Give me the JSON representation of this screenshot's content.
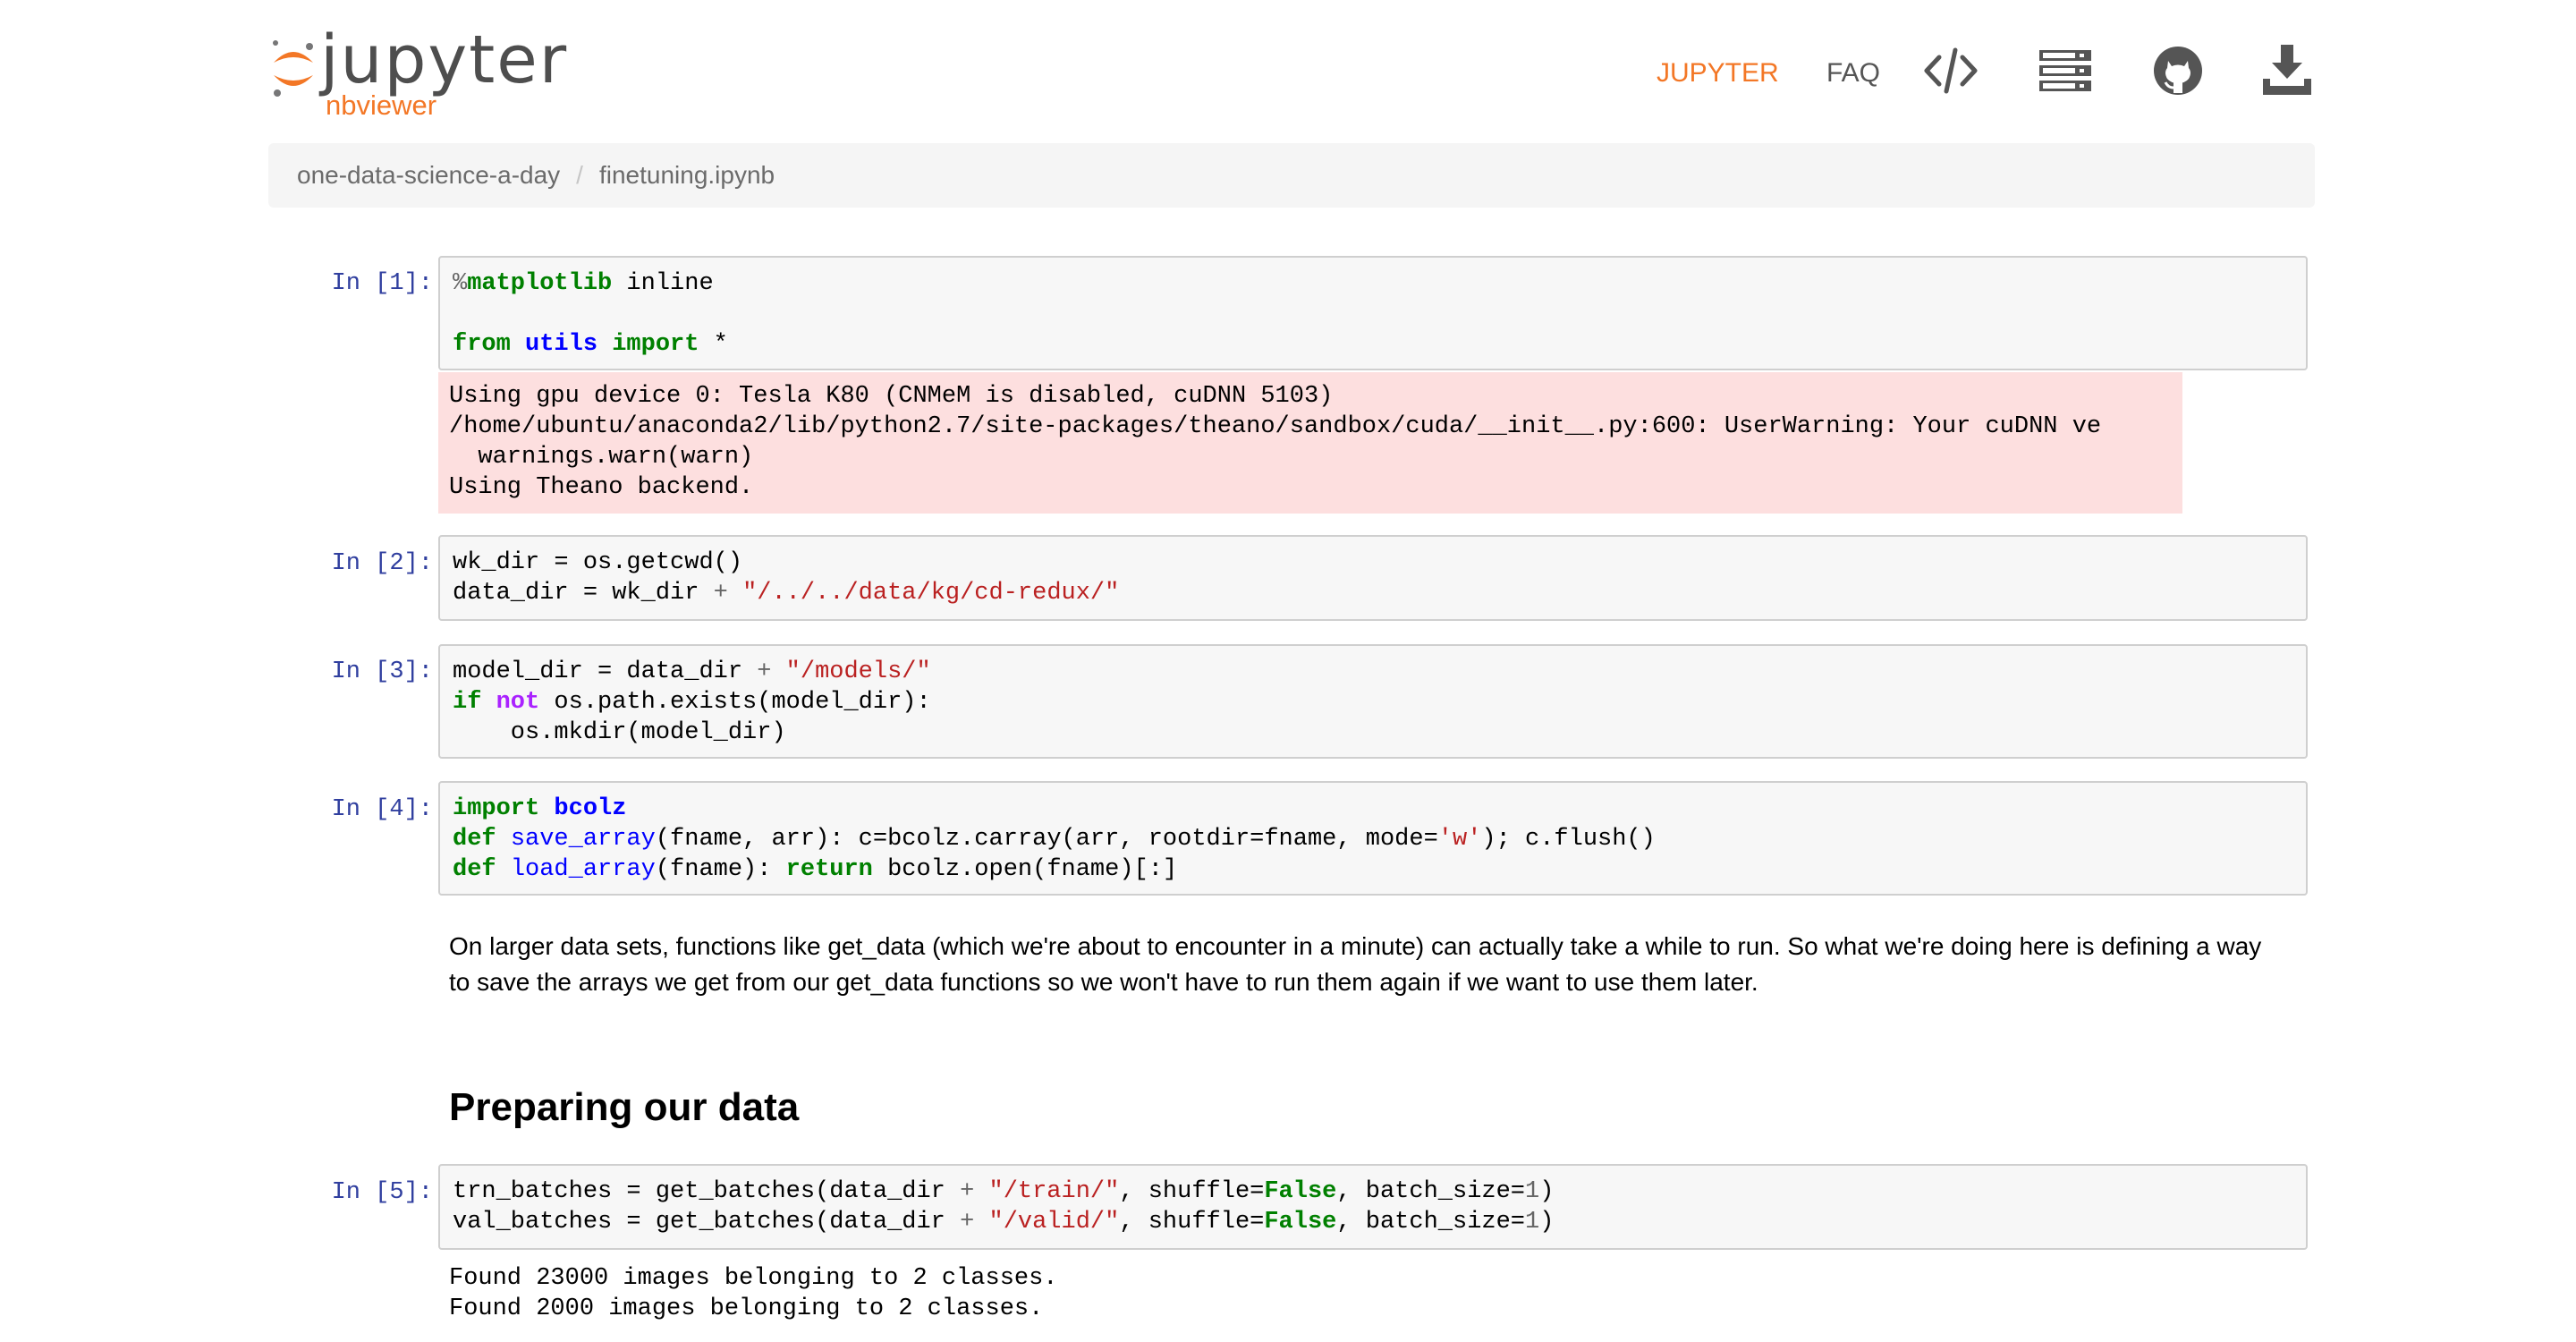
{
  "brand": {
    "name": "jupyter",
    "sub": "nbviewer",
    "accent": "#f37726"
  },
  "nav": {
    "jupyter": "JUPYTER",
    "faq": "FAQ",
    "icons": [
      "code-icon",
      "list-icon",
      "github-icon",
      "download-icon"
    ]
  },
  "breadcrumb": {
    "items": [
      "one-data-science-a-day",
      "finetuning.ipynb"
    ],
    "separator": "/"
  },
  "cells": {
    "c1": {
      "prompt": "In [1]:",
      "line1_magic": "%",
      "line1_cmd": "matplotlib",
      "line1_rest": " inline",
      "line2_from": "from",
      "line2_mod": "utils",
      "line2_import": "import",
      "line2_rest": " *",
      "stderr": [
        "Using gpu device 0: Tesla K80 (CNMeM is disabled, cuDNN 5103)",
        "/home/ubuntu/anaconda2/lib/python2.7/site-packages/theano/sandbox/cuda/__init__.py:600: UserWarning: Your cuDNN ve",
        "  warnings.warn(warn)",
        "Using Theano backend."
      ]
    },
    "c2": {
      "prompt": "In [2]:",
      "l1_var": "wk_dir",
      "l1_rest": " = os.getcwd()",
      "l2_var": "data_dir",
      "l2_mid": " = wk_dir ",
      "l2_op": "+",
      "l2_str": "\"/../../data/kg/cd-redux/\""
    },
    "c3": {
      "prompt": "In [3]:",
      "l1_pre": "model_dir = data_dir ",
      "l1_op": "+",
      "l1_str": "\"/models/\"",
      "l2_if": "if",
      "l2_not": "not",
      "l2_rest": " os.path.exists(model_dir):",
      "l3": "    os.mkdir(model_dir)"
    },
    "c4": {
      "prompt": "In [4]:",
      "l1_import": "import",
      "l1_mod": "bcolz",
      "l2_def": "def",
      "l2_fn": "save_array",
      "l2_a": "(fname, arr): c=bcolz.carray(arr, rootdir=fname, mode=",
      "l2_str": "'w'",
      "l2_b": "); c.flush()",
      "l3_def": "def",
      "l3_fn": "load_array",
      "l3_a": "(fname): ",
      "l3_ret": "return",
      "l3_b": " bcolz.open(fname)[:]"
    },
    "md1": {
      "line1": "On larger data sets, functions like get_data (which we're about to encounter in a minute) can actually take a while to run. So what we're doing here is defining a way",
      "line2": "to save the arrays we get from our get_data functions so we won't have to run them again if we want to use them later."
    },
    "h1": "Preparing our data",
    "c5": {
      "prompt": "In [5]:",
      "l1_a": "trn_batches = get_batches(data_dir ",
      "l1_str": "\"/train/\"",
      "l1_b": ", shuffle=",
      "l1_false": "False",
      "l1_c": ", batch_size=",
      "l1_num": "1",
      "l1_d": ")",
      "l2_a": "val_batches = get_batches(data_dir ",
      "l2_str": "\"/valid/\"",
      "l2_b": ", shuffle=",
      "l2_false": "False",
      "l2_c": ", batch_size=",
      "l2_num": "1",
      "l2_d": ")",
      "plus": "+",
      "out": [
        "Found 23000 images belonging to 2 classes.",
        "Found 2000 images belonging to 2 classes."
      ]
    }
  }
}
